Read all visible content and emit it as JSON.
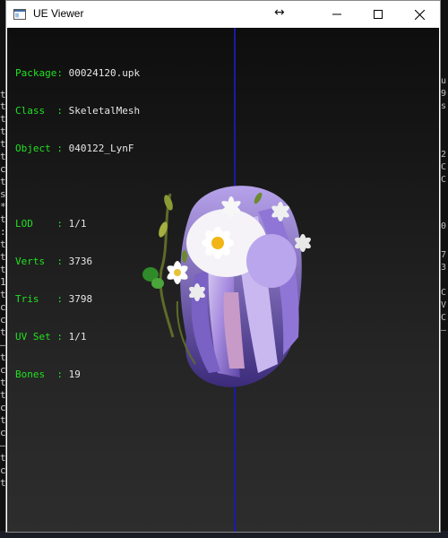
{
  "window": {
    "title": "UE Viewer"
  },
  "info": {
    "package_label": "Package",
    "package_value": "00024120.upk",
    "class_label": "Class  ",
    "class_value": "SkeletalMesh",
    "object_label": "Object ",
    "object_value": "040122_LynF",
    "lod_label": "LOD    ",
    "lod_value": "1/1",
    "verts_label": "Verts  ",
    "verts_value": "3736",
    "tris_label": "Tris   ",
    "tris_value": "3798",
    "uvset_label": "UV Set ",
    "uvset_value": "1/1",
    "bones_label": "Bones  ",
    "bones_value": "19"
  },
  "colors": {
    "label_green": "#22e022",
    "value_white": "#e6e6e6",
    "axis_blue": "#1a1aa8"
  },
  "icons": {
    "app": "window-icon",
    "cursor": "resize-horizontal-cursor",
    "minimize": "minimize-icon",
    "maximize": "maximize-icon",
    "close": "close-icon"
  }
}
